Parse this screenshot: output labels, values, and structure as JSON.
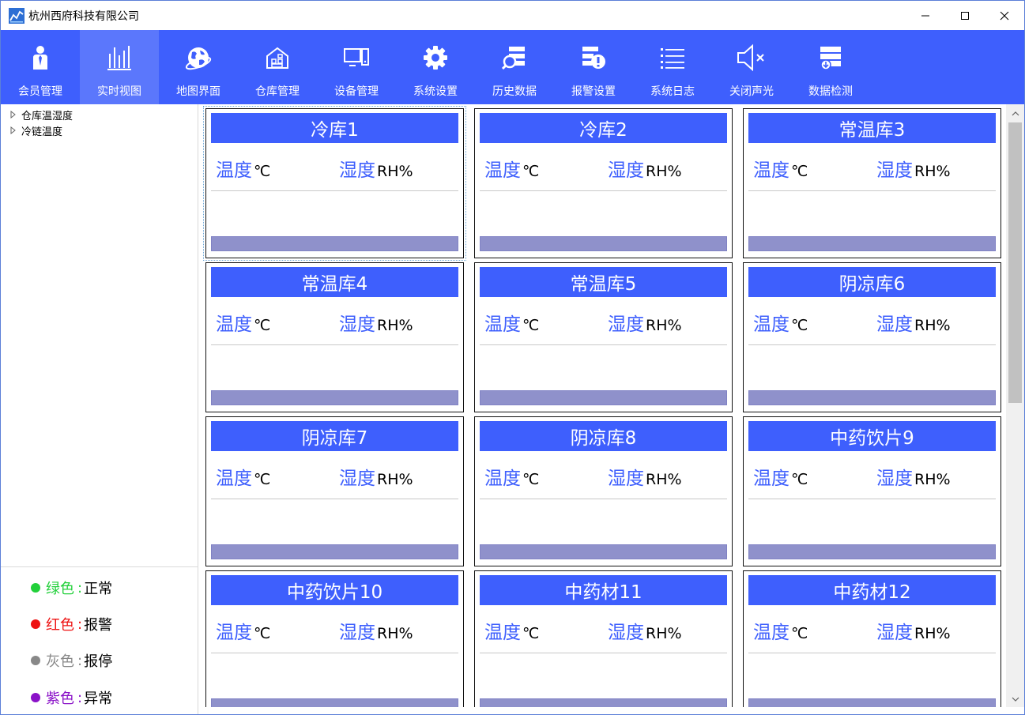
{
  "window": {
    "title": "杭州西府科技有限公司",
    "minimize_glyph": "—",
    "maximize_glyph": "☐",
    "close_glyph": "✕"
  },
  "toolbar": {
    "items": [
      {
        "label": "会员管理",
        "icon": "member-icon",
        "active": false
      },
      {
        "label": "实时视图",
        "icon": "realtime-chart-icon",
        "active": true
      },
      {
        "label": "地图界面",
        "icon": "globe-icon",
        "active": false
      },
      {
        "label": "仓库管理",
        "icon": "warehouse-icon",
        "active": false
      },
      {
        "label": "设备管理",
        "icon": "devices-icon",
        "active": false
      },
      {
        "label": "系统设置",
        "icon": "gear-icon",
        "active": false
      },
      {
        "label": "历史数据",
        "icon": "history-search-icon",
        "active": false
      },
      {
        "label": "报警设置",
        "icon": "alarm-settings-icon",
        "active": false
      },
      {
        "label": "系统日志",
        "icon": "log-list-icon",
        "active": false
      },
      {
        "label": "关闭声光",
        "icon": "mute-icon",
        "active": false
      },
      {
        "label": "数据检测",
        "icon": "data-check-icon",
        "active": false
      }
    ]
  },
  "tree": {
    "items": [
      {
        "label": "仓库温湿度"
      },
      {
        "label": "冷链温度"
      }
    ]
  },
  "legend": {
    "items": [
      {
        "color_name": "绿色",
        "sep": ":",
        "meaning": "正常",
        "color": "#22d03a",
        "text_color": "#22d03a"
      },
      {
        "color_name": "红色",
        "sep": ":",
        "meaning": "报警",
        "color": "#ee1111",
        "text_color": "#ee1111"
      },
      {
        "color_name": "灰色",
        "sep": ":",
        "meaning": "报停",
        "color": "#888888",
        "text_color": "#888888"
      },
      {
        "color_name": "紫色",
        "sep": ":",
        "meaning": "异常",
        "color": "#8a12c8",
        "text_color": "#8a12c8"
      }
    ]
  },
  "cards": {
    "temp_key": "温度",
    "temp_unit": "℃",
    "hum_key": "湿度",
    "hum_unit": "RH%",
    "items": [
      {
        "title": "冷库1"
      },
      {
        "title": "冷库2"
      },
      {
        "title": "常温库3"
      },
      {
        "title": "常温库4"
      },
      {
        "title": "常温库5"
      },
      {
        "title": "阴凉库6"
      },
      {
        "title": "阴凉库7"
      },
      {
        "title": "阴凉库8"
      },
      {
        "title": "中药饮片9"
      },
      {
        "title": "中药饮片10"
      },
      {
        "title": "中药材11"
      },
      {
        "title": "中药材12"
      }
    ]
  },
  "colors": {
    "accent": "#3e5ffd",
    "status_bar": "#8f91cb"
  }
}
